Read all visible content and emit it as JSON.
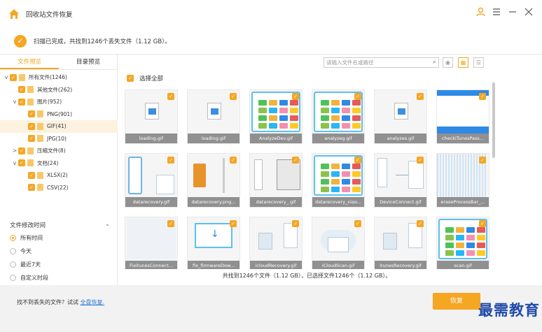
{
  "window": {
    "title": "回收站文件恢复"
  },
  "status": {
    "text": "扫描已完成，共找到1246个丢失文件（1.12 GB）。"
  },
  "tabs": [
    {
      "label": "文件预览"
    },
    {
      "label": "目录预览"
    }
  ],
  "tree": [
    {
      "label": "所有文件(1246)",
      "arrow": "v"
    },
    {
      "label": "其他文件(262)",
      "arrow": ""
    },
    {
      "label": "图片(952)",
      "arrow": "v"
    },
    {
      "label": "PNG(901)",
      "arrow": ""
    },
    {
      "label": "GIF(41)",
      "arrow": ""
    },
    {
      "label": "JPG(10)",
      "arrow": ""
    },
    {
      "label": "压缩文件(8)",
      "arrow": ">"
    },
    {
      "label": "文档(24)",
      "arrow": "v"
    },
    {
      "label": "XLSX(2)",
      "arrow": ""
    },
    {
      "label": "CSV(22)",
      "arrow": ""
    }
  ],
  "filter": {
    "title": "文件修改时间",
    "options": [
      "所有时间",
      "今天",
      "最近7天",
      "自定义时段"
    ]
  },
  "search": {
    "placeholder": "请输入文件名或路径"
  },
  "select_all": "选择全部",
  "files": [
    "loading.gif",
    "loading.gif",
    "AnalyzeDev.gif",
    "analyzeg.gif",
    "analyzes.gif",
    "checkiTunesPass...",
    "datarecovery.gif",
    "datarecovery.png...",
    "datarecovery_.gif",
    "datarecovery_xiao...",
    "DeviceConnect.gif",
    "eraseProcessBar_...",
    "FixitunesConnect...",
    "fix_firmwareDow...",
    "icloudRecovery.gif",
    "iCloudScan.gif",
    "itunesRecovery.gif",
    "scan.gif"
  ],
  "summary": "共找到1246个文件（1.12 GB），已选择文件1246个（1.12 GB）。",
  "footer": {
    "help_text": "找不到丢失的文件？试试",
    "help_link": "全盘恢复."
  },
  "recover_button": "恢复",
  "watermark": "最需教育",
  "colors": {
    "accent": "#f5a623",
    "link": "#2e7bd6",
    "watermark": "#1f4aa8"
  }
}
